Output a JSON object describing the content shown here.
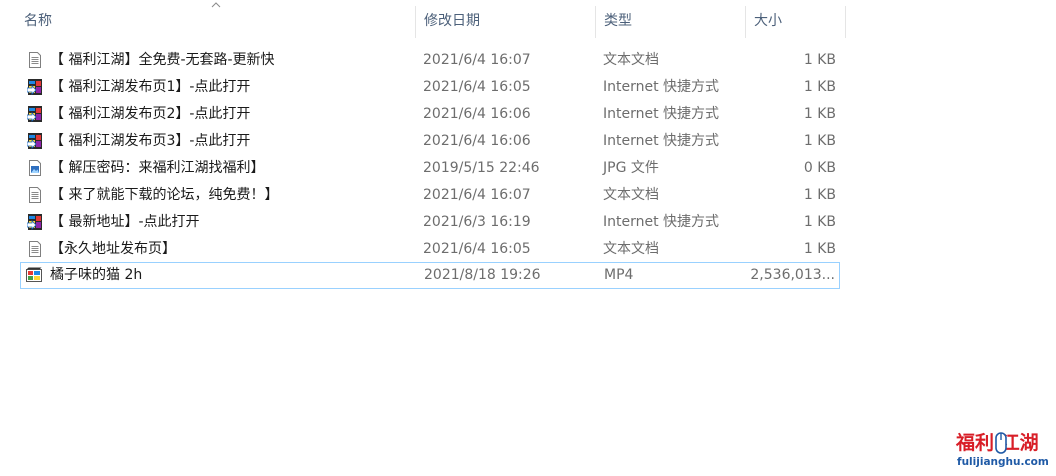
{
  "columns": {
    "name": "名称",
    "date": "修改日期",
    "type": "类型",
    "size": "大小"
  },
  "files": [
    {
      "name": "【 福利江湖】全免费-无套路-更新快",
      "date": "2021/6/4 16:07",
      "type": "文本文档",
      "size": "1 KB",
      "icon": "text-file-icon"
    },
    {
      "name": "【 福利江湖发布页1】-点此打开",
      "date": "2021/6/4 16:05",
      "type": "Internet 快捷方式",
      "size": "1 KB",
      "icon": "internet-shortcut-icon"
    },
    {
      "name": "【 福利江湖发布页2】-点此打开",
      "date": "2021/6/4 16:06",
      "type": "Internet 快捷方式",
      "size": "1 KB",
      "icon": "internet-shortcut-icon"
    },
    {
      "name": "【 福利江湖发布页3】-点此打开",
      "date": "2021/6/4 16:06",
      "type": "Internet 快捷方式",
      "size": "1 KB",
      "icon": "internet-shortcut-icon"
    },
    {
      "name": "【 解压密码：来福利江湖找福利】",
      "date": "2019/5/15 22:46",
      "type": "JPG 文件",
      "size": "0 KB",
      "icon": "image-file-icon"
    },
    {
      "name": "【 来了就能下载的论坛，纯免费！】",
      "date": "2021/6/4 16:07",
      "type": "文本文档",
      "size": "1 KB",
      "icon": "text-file-icon"
    },
    {
      "name": "【 最新地址】-点此打开",
      "date": "2021/6/3 16:19",
      "type": "Internet 快捷方式",
      "size": "1 KB",
      "icon": "internet-shortcut-icon"
    },
    {
      "name": "【永久地址发布页】",
      "date": "2021/6/4 16:05",
      "type": "文本文档",
      "size": "1 KB",
      "icon": "text-file-icon"
    },
    {
      "name": "橘子味的猫 2h",
      "date": "2021/8/18 19:26",
      "type": "MP4",
      "size": "2,536,013...",
      "icon": "video-file-icon",
      "selected": true
    }
  ],
  "watermark": {
    "title": "福利 江湖",
    "url": "fulijianghu.com"
  },
  "colors": {
    "header_text": "#4c607a",
    "detail_text": "#6d6d6d",
    "selection_border": "#99d1ff",
    "watermark_red": "#d81e27",
    "watermark_blue": "#1f5aa6"
  }
}
